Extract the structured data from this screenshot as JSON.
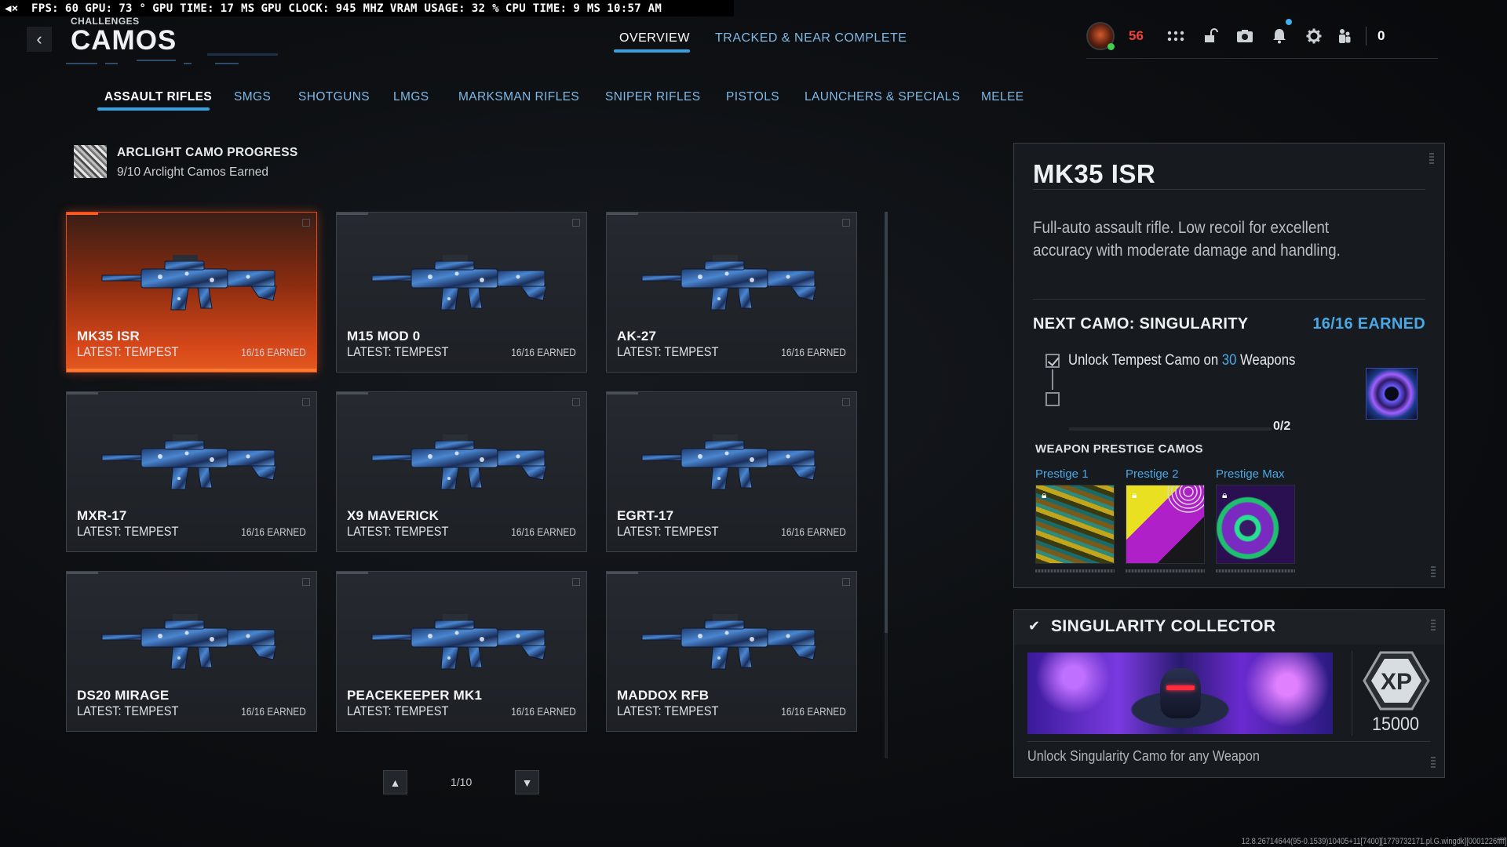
{
  "perf": {
    "fps_label": "FPS:",
    "fps": "60",
    "gpu_label": "GPU:",
    "gpu": "73 °",
    "gpu_time_label": "GPU TIME:",
    "gpu_time": "17 MS",
    "gpu_clock_label": "GPU CLOCK:",
    "gpu_clock": "945 MHZ",
    "vram_label": "VRAM USAGE:",
    "vram": "32 %",
    "cpu_time_label": "CPU TIME:",
    "cpu_time": "9 MS",
    "clock": "10:57 AM"
  },
  "header": {
    "breadcrumb": "CHALLENGES",
    "title": "CAMOS",
    "tabs": [
      {
        "label": "OVERVIEW",
        "active": true
      },
      {
        "label": "TRACKED & NEAR COMPLETE",
        "active": false
      }
    ],
    "player_level": "56",
    "currency": "0",
    "icons": [
      "avatar-icon",
      "grid-icon",
      "unlock-icon",
      "camera-icon",
      "bell-icon",
      "gear-icon",
      "party-icon"
    ]
  },
  "categories": [
    {
      "label": "ASSAULT RIFLES",
      "active": true
    },
    {
      "label": "SMGS"
    },
    {
      "label": "SHOTGUNS"
    },
    {
      "label": "LMGS"
    },
    {
      "label": "MARKSMAN RIFLES"
    },
    {
      "label": "SNIPER RIFLES"
    },
    {
      "label": "PISTOLS"
    },
    {
      "label": "LAUNCHERS & SPECIALS"
    },
    {
      "label": "MELEE"
    }
  ],
  "progress": {
    "title": "ARCLIGHT CAMO PROGRESS",
    "subtitle": "9/10 Arclight Camos Earned"
  },
  "weapons": [
    {
      "name": "MK35 ISR",
      "latest": "LATEST: TEMPEST",
      "earned": "16/16 EARNED",
      "selected": true
    },
    {
      "name": "M15 MOD 0",
      "latest": "LATEST: TEMPEST",
      "earned": "16/16 EARNED"
    },
    {
      "name": "AK-27",
      "latest": "LATEST: TEMPEST",
      "earned": "16/16 EARNED"
    },
    {
      "name": "MXR-17",
      "latest": "LATEST: TEMPEST",
      "earned": "16/16 EARNED"
    },
    {
      "name": "X9 MAVERICK",
      "latest": "LATEST: TEMPEST",
      "earned": "16/16 EARNED"
    },
    {
      "name": "EGRT-17",
      "latest": "LATEST: TEMPEST",
      "earned": "16/16 EARNED"
    },
    {
      "name": "DS20 MIRAGE",
      "latest": "LATEST: TEMPEST",
      "earned": "16/16 EARNED"
    },
    {
      "name": "PEACEKEEPER MK1",
      "latest": "LATEST: TEMPEST",
      "earned": "16/16 EARNED"
    },
    {
      "name": "MADDOX RFB",
      "latest": "LATEST: TEMPEST",
      "earned": "16/16 EARNED"
    }
  ],
  "pagination": {
    "label": "1/10",
    "prev_icon": "chevron-up-icon",
    "next_icon": "chevron-down-icon"
  },
  "detail": {
    "name": "MK35 ISR",
    "description": "Full-auto assault rifle. Low recoil for excellent accuracy with moderate damage and handling.",
    "next_camo": "NEXT CAMO: SINGULARITY",
    "next_earned": "16/16 EARNED",
    "requirement_pre": "Unlock Tempest Camo on ",
    "requirement_num": "30",
    "requirement_post": " Weapons",
    "requirement_count": "0/2",
    "prestige_title": "WEAPON PRESTIGE CAMOS",
    "prestige": [
      {
        "label": "Prestige 1"
      },
      {
        "label": "Prestige 2"
      },
      {
        "label": "Prestige Max"
      }
    ]
  },
  "collector": {
    "title": "SINGULARITY COLLECTOR",
    "xp_label": "XP",
    "xp": "15000",
    "description": "Unlock Singularity Camo for any Weapon"
  },
  "build": "12.8.26714644(95-0.1539)10405+11[7400][1779732171.pl.G.wingdk][0001226ffff]",
  "colors": {
    "accent": "#36a0e0",
    "highlight": "#4aa8e6",
    "selected_card": "#e25a20",
    "level": "#f0433a"
  }
}
